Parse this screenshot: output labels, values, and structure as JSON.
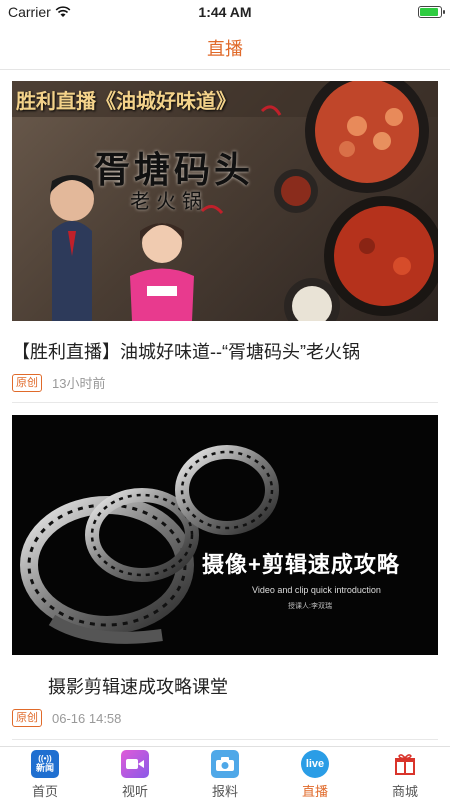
{
  "status": {
    "carrier": "Carrier",
    "time": "1:44 AM"
  },
  "nav": {
    "title": "直播"
  },
  "cards": [
    {
      "title": "【胜利直播】油城好味道--“胥塘码头”老火锅",
      "badge": "原创",
      "time": "13小时前",
      "thumb": {
        "banner": "胜利直播《油城好味道》",
        "headline": "胥塘码头",
        "subtitle": "老火锅"
      }
    },
    {
      "title": "摄影剪辑速成攻略课堂",
      "badge": "原创",
      "time": "06-16 14:58",
      "thumb": {
        "headline": "摄像+剪辑速成攻略",
        "en": "Video and clip quick introduction",
        "credit": "授课人:李双瑞"
      }
    }
  ],
  "tabs": [
    {
      "label": "首页",
      "icon": "news-icon",
      "icon_text": "新闻"
    },
    {
      "label": "视听",
      "icon": "video-camera-icon"
    },
    {
      "label": "报料",
      "icon": "camera-icon"
    },
    {
      "label": "直播",
      "icon": "live-icon",
      "icon_text": "live"
    },
    {
      "label": "商城",
      "icon": "gift-icon"
    }
  ],
  "colors": {
    "accent": "#e06a2a",
    "live_blue": "#2a9de6",
    "news_blue": "#1f6fd0"
  }
}
